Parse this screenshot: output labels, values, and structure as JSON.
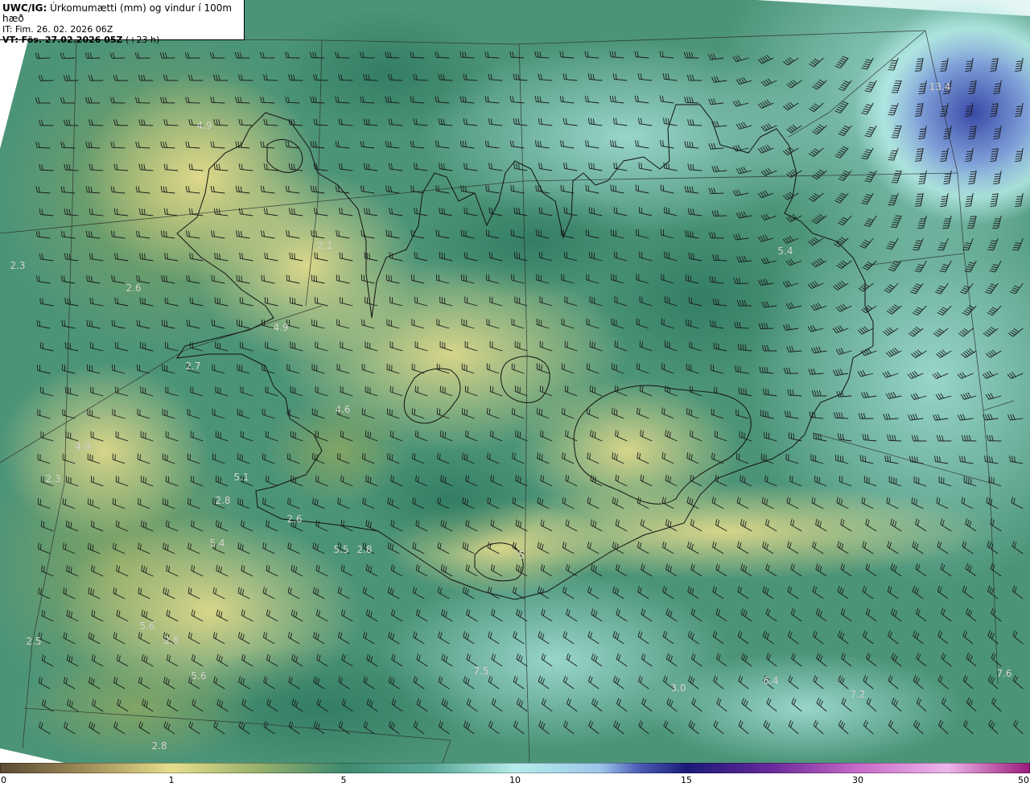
{
  "header": {
    "product": "UWC/IG:",
    "description": "Úrkomumætti (mm) og vindur í 100m hæð",
    "initial_time": "IT: Fim. 26. 02. 2026 06Z",
    "valid_prefix": "VT: Fös. 27.02.2026 05Z",
    "valid_suffix": "(+23 h)"
  },
  "labels": [
    "4.9",
    "2.1",
    "2.3",
    "2.6",
    "4.9",
    "2.7",
    "4.6",
    "4.9",
    "2.3",
    "5.1",
    "2.8",
    "2.6",
    "5.4",
    "5.5",
    "2.8",
    "5.6",
    "2.5",
    "2.8",
    "5.6",
    "7.5",
    "3.0",
    "6.4",
    "7.2",
    "7.6",
    "2.8",
    "13.4",
    "5.4",
    "5"
  ],
  "colorbar": {
    "ticks": [
      "0",
      "1",
      "5",
      "10",
      "15",
      "30",
      "50"
    ],
    "colors": [
      "#5a4a33",
      "#9c8a56",
      "#e6de8c",
      "#98b06c",
      "#3f8a6e",
      "#5aa898",
      "#b6ecea",
      "#9cc6ea",
      "#4d5db6",
      "#1a1a78",
      "#6a2a9a",
      "#c86ac8",
      "#ecb6ea",
      "#9a1a7a"
    ]
  },
  "colors": {
    "low": "#e2d98a",
    "mid": "#3f8a6e",
    "high": "#b6ecea",
    "max": "#3a4aa8"
  }
}
